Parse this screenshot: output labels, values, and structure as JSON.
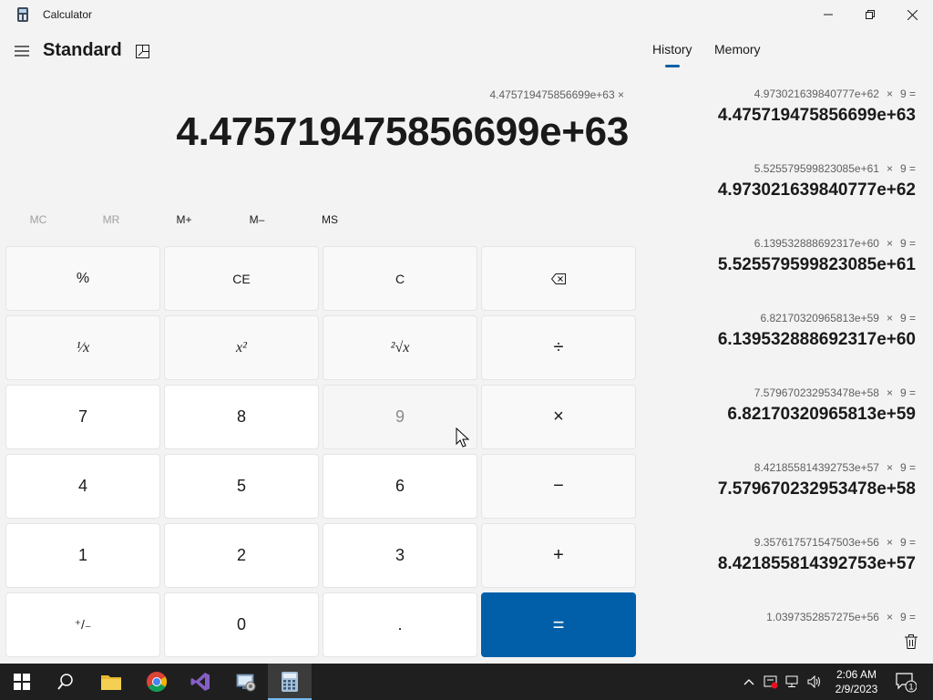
{
  "window": {
    "title": "Calculator"
  },
  "header": {
    "mode": "Standard"
  },
  "display": {
    "expression": "4.475719475856699e+63 ×",
    "result": "4.475719475856699e+63"
  },
  "memory_buttons": [
    "MC",
    "MR",
    "M+",
    "M–",
    "MS"
  ],
  "keys": {
    "percent": "%",
    "ce": "CE",
    "c": "C",
    "backspace": "⌫",
    "reciprocal": "¹⁄x",
    "square": "x²",
    "sqrt": "²√x",
    "divide": "÷",
    "seven": "7",
    "eight": "8",
    "nine": "9",
    "multiply": "×",
    "four": "4",
    "five": "5",
    "six": "6",
    "minus": "−",
    "one": "1",
    "two": "2",
    "three": "3",
    "plus": "+",
    "negate": "⁺/₋",
    "zero": "0",
    "decimal": ".",
    "equals": "="
  },
  "panel": {
    "tabs": [
      "History",
      "Memory"
    ],
    "history": [
      {
        "operand": "4.973021639840777e+62",
        "op": "×",
        "value": "9",
        "eq": "=",
        "result": "4.475719475856699e+63"
      },
      {
        "operand": "5.525579599823085e+61",
        "op": "×",
        "value": "9",
        "eq": "=",
        "result": "4.973021639840777e+62"
      },
      {
        "operand": "6.139532888692317e+60",
        "op": "×",
        "value": "9",
        "eq": "=",
        "result": "5.525579599823085e+61"
      },
      {
        "operand": "6.82170320965813e+59",
        "op": "×",
        "value": "9",
        "eq": "=",
        "result": "6.139532888692317e+60"
      },
      {
        "operand": "7.579670232953478e+58",
        "op": "×",
        "value": "9",
        "eq": "=",
        "result": "6.82170320965813e+59"
      },
      {
        "operand": "8.421855814392753e+57",
        "op": "×",
        "value": "9",
        "eq": "=",
        "result": "7.579670232953478e+58"
      },
      {
        "operand": "9.357617571547503e+56",
        "op": "×",
        "value": "9",
        "eq": "=",
        "result": "8.421855814392753e+57"
      },
      {
        "operand": "1.0397352857275e+56",
        "op": "×",
        "value": "9",
        "eq": "=",
        "result": ""
      }
    ]
  },
  "taskbar": {
    "clock_time": "2:06 AM",
    "clock_date": "2/9/2023",
    "notification_count": "1"
  },
  "colors": {
    "accent": "#005fa8",
    "background": "#f3f3f3",
    "taskbar": "#1f1f1f"
  }
}
